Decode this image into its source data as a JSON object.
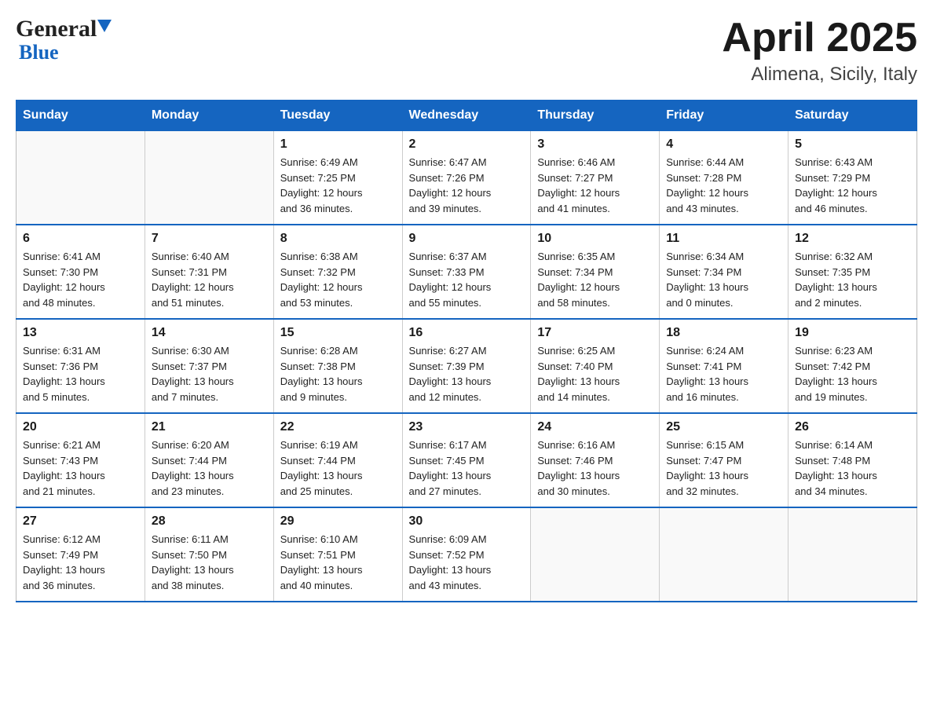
{
  "header": {
    "logo_general": "General",
    "logo_blue": "Blue",
    "title": "April 2025",
    "subtitle": "Alimena, Sicily, Italy"
  },
  "weekdays": [
    "Sunday",
    "Monday",
    "Tuesday",
    "Wednesday",
    "Thursday",
    "Friday",
    "Saturday"
  ],
  "weeks": [
    [
      {
        "day": "",
        "info": ""
      },
      {
        "day": "",
        "info": ""
      },
      {
        "day": "1",
        "info": "Sunrise: 6:49 AM\nSunset: 7:25 PM\nDaylight: 12 hours\nand 36 minutes."
      },
      {
        "day": "2",
        "info": "Sunrise: 6:47 AM\nSunset: 7:26 PM\nDaylight: 12 hours\nand 39 minutes."
      },
      {
        "day": "3",
        "info": "Sunrise: 6:46 AM\nSunset: 7:27 PM\nDaylight: 12 hours\nand 41 minutes."
      },
      {
        "day": "4",
        "info": "Sunrise: 6:44 AM\nSunset: 7:28 PM\nDaylight: 12 hours\nand 43 minutes."
      },
      {
        "day": "5",
        "info": "Sunrise: 6:43 AM\nSunset: 7:29 PM\nDaylight: 12 hours\nand 46 minutes."
      }
    ],
    [
      {
        "day": "6",
        "info": "Sunrise: 6:41 AM\nSunset: 7:30 PM\nDaylight: 12 hours\nand 48 minutes."
      },
      {
        "day": "7",
        "info": "Sunrise: 6:40 AM\nSunset: 7:31 PM\nDaylight: 12 hours\nand 51 minutes."
      },
      {
        "day": "8",
        "info": "Sunrise: 6:38 AM\nSunset: 7:32 PM\nDaylight: 12 hours\nand 53 minutes."
      },
      {
        "day": "9",
        "info": "Sunrise: 6:37 AM\nSunset: 7:33 PM\nDaylight: 12 hours\nand 55 minutes."
      },
      {
        "day": "10",
        "info": "Sunrise: 6:35 AM\nSunset: 7:34 PM\nDaylight: 12 hours\nand 58 minutes."
      },
      {
        "day": "11",
        "info": "Sunrise: 6:34 AM\nSunset: 7:34 PM\nDaylight: 13 hours\nand 0 minutes."
      },
      {
        "day": "12",
        "info": "Sunrise: 6:32 AM\nSunset: 7:35 PM\nDaylight: 13 hours\nand 2 minutes."
      }
    ],
    [
      {
        "day": "13",
        "info": "Sunrise: 6:31 AM\nSunset: 7:36 PM\nDaylight: 13 hours\nand 5 minutes."
      },
      {
        "day": "14",
        "info": "Sunrise: 6:30 AM\nSunset: 7:37 PM\nDaylight: 13 hours\nand 7 minutes."
      },
      {
        "day": "15",
        "info": "Sunrise: 6:28 AM\nSunset: 7:38 PM\nDaylight: 13 hours\nand 9 minutes."
      },
      {
        "day": "16",
        "info": "Sunrise: 6:27 AM\nSunset: 7:39 PM\nDaylight: 13 hours\nand 12 minutes."
      },
      {
        "day": "17",
        "info": "Sunrise: 6:25 AM\nSunset: 7:40 PM\nDaylight: 13 hours\nand 14 minutes."
      },
      {
        "day": "18",
        "info": "Sunrise: 6:24 AM\nSunset: 7:41 PM\nDaylight: 13 hours\nand 16 minutes."
      },
      {
        "day": "19",
        "info": "Sunrise: 6:23 AM\nSunset: 7:42 PM\nDaylight: 13 hours\nand 19 minutes."
      }
    ],
    [
      {
        "day": "20",
        "info": "Sunrise: 6:21 AM\nSunset: 7:43 PM\nDaylight: 13 hours\nand 21 minutes."
      },
      {
        "day": "21",
        "info": "Sunrise: 6:20 AM\nSunset: 7:44 PM\nDaylight: 13 hours\nand 23 minutes."
      },
      {
        "day": "22",
        "info": "Sunrise: 6:19 AM\nSunset: 7:44 PM\nDaylight: 13 hours\nand 25 minutes."
      },
      {
        "day": "23",
        "info": "Sunrise: 6:17 AM\nSunset: 7:45 PM\nDaylight: 13 hours\nand 27 minutes."
      },
      {
        "day": "24",
        "info": "Sunrise: 6:16 AM\nSunset: 7:46 PM\nDaylight: 13 hours\nand 30 minutes."
      },
      {
        "day": "25",
        "info": "Sunrise: 6:15 AM\nSunset: 7:47 PM\nDaylight: 13 hours\nand 32 minutes."
      },
      {
        "day": "26",
        "info": "Sunrise: 6:14 AM\nSunset: 7:48 PM\nDaylight: 13 hours\nand 34 minutes."
      }
    ],
    [
      {
        "day": "27",
        "info": "Sunrise: 6:12 AM\nSunset: 7:49 PM\nDaylight: 13 hours\nand 36 minutes."
      },
      {
        "day": "28",
        "info": "Sunrise: 6:11 AM\nSunset: 7:50 PM\nDaylight: 13 hours\nand 38 minutes."
      },
      {
        "day": "29",
        "info": "Sunrise: 6:10 AM\nSunset: 7:51 PM\nDaylight: 13 hours\nand 40 minutes."
      },
      {
        "day": "30",
        "info": "Sunrise: 6:09 AM\nSunset: 7:52 PM\nDaylight: 13 hours\nand 43 minutes."
      },
      {
        "day": "",
        "info": ""
      },
      {
        "day": "",
        "info": ""
      },
      {
        "day": "",
        "info": ""
      }
    ]
  ]
}
